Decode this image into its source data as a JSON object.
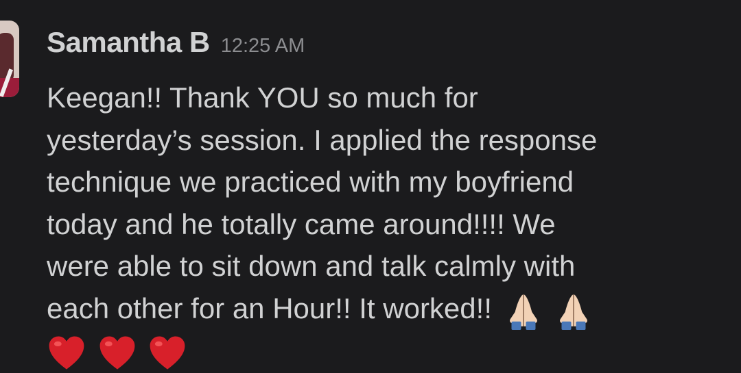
{
  "message": {
    "sender": "Samantha B",
    "time": "12:25 AM",
    "lines": [
      "Keegan!! Thank YOU so much for",
      "yesterday’s session. I applied the response",
      "technique we practiced with my boyfriend",
      "today and he totally came around!!!! We",
      "were able to sit down and talk calmly with",
      "each other for an Hour!! It worked!!"
    ],
    "emojis": {
      "pray": "folded-hands-icon",
      "heart": "red-heart-icon",
      "pray_count": 2,
      "heart_count": 3
    },
    "colors": {
      "background": "#1b1b1d",
      "text": "#d1d2d3",
      "timestamp": "#8c8d90",
      "heart": "#d8202a",
      "hands": "#f2d2b6"
    }
  }
}
